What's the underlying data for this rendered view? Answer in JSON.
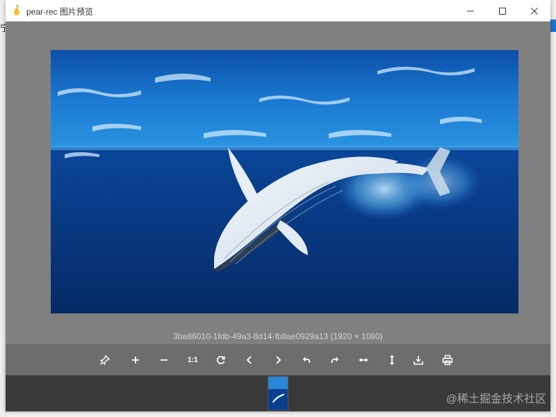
{
  "window": {
    "title": "pear-rec 图片预览",
    "app_icon": "pear-icon",
    "controls": {
      "minimize": "minimize-icon",
      "maximize": "maximize-icon",
      "close": "close-icon"
    }
  },
  "image": {
    "caption": "3ba86010-1fdb-49a3-8d14-fb8ae0929a13 (1920 × 1080)",
    "subject": "humpback whale underwater"
  },
  "toolbar": {
    "items": [
      {
        "name": "pin-button",
        "icon": "pin-icon",
        "label": ""
      },
      {
        "name": "zoom-in-button",
        "icon": "plus-icon",
        "label": ""
      },
      {
        "name": "zoom-out-button",
        "icon": "minus-icon",
        "label": ""
      },
      {
        "name": "actual-size-button",
        "icon": "one-to-one-icon",
        "label": "1:1"
      },
      {
        "name": "reset-button",
        "icon": "refresh-icon",
        "label": ""
      },
      {
        "name": "previous-button",
        "icon": "chevron-left-icon",
        "label": ""
      },
      {
        "name": "next-button",
        "icon": "chevron-right-icon",
        "label": ""
      },
      {
        "name": "rotate-left-button",
        "icon": "rotate-left-icon",
        "label": ""
      },
      {
        "name": "rotate-right-button",
        "icon": "rotate-right-icon",
        "label": ""
      },
      {
        "name": "flip-horizontal-button",
        "icon": "flip-horizontal-icon",
        "label": ""
      },
      {
        "name": "flip-vertical-button",
        "icon": "flip-vertical-icon",
        "label": ""
      },
      {
        "name": "download-button",
        "icon": "download-icon",
        "label": ""
      },
      {
        "name": "print-button",
        "icon": "printer-icon",
        "label": ""
      }
    ]
  },
  "watermark": "@稀土掘金技术社区",
  "colors": {
    "viewer_bg": "#808080",
    "toolbar_bg": "#6d6d6d",
    "thumbstrip_bg": "#3a3a3a",
    "icon": "#ffffff"
  }
}
